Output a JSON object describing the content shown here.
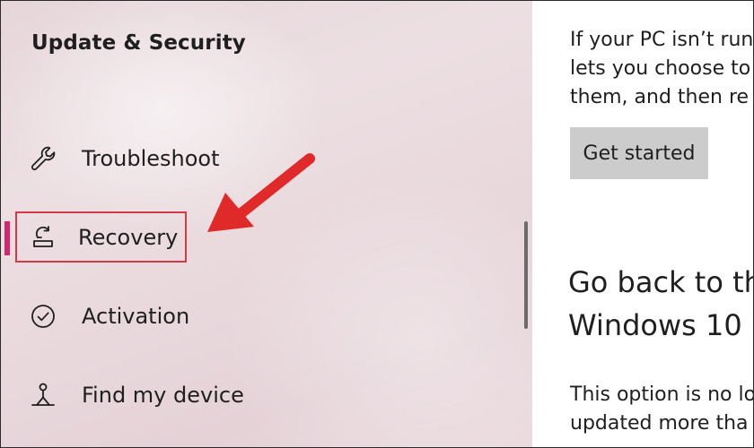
{
  "sidebar": {
    "title": "Update & Security",
    "items": [
      {
        "label": "Troubleshoot",
        "icon": "wrench-icon"
      },
      {
        "label": "Recovery",
        "icon": "recovery-icon",
        "selected": true
      },
      {
        "label": "Activation",
        "icon": "check-circle-icon"
      },
      {
        "label": "Find my device",
        "icon": "person-location-icon"
      }
    ]
  },
  "content": {
    "intro_lines": [
      "If your PC isn’t run",
      "lets you choose to",
      "them, and then re"
    ],
    "get_started_label": "Get started",
    "heading_lines": [
      "Go back to th",
      "Windows 10"
    ],
    "option_lines": [
      "This option is no lo",
      "updated more tha"
    ]
  },
  "colors": {
    "accent": "#d7256f",
    "highlight_box": "#d23a4a",
    "arrow": "#e02a2a",
    "button_bg": "#cccccc"
  }
}
